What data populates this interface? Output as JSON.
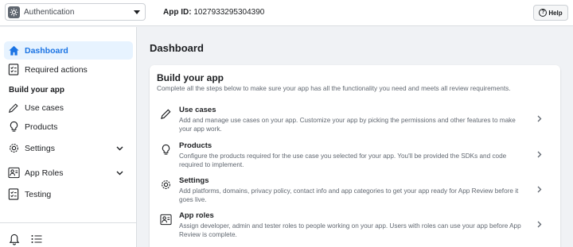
{
  "topbar": {
    "app_name": "Authentication",
    "app_id_label": "App ID:",
    "app_id_value": "1027933295304390",
    "help_label": "Help"
  },
  "sidebar": {
    "items_top": [
      {
        "label": "Dashboard",
        "icon": "home-icon",
        "active": true
      },
      {
        "label": "Required actions",
        "icon": "checklist-icon",
        "active": false
      }
    ],
    "section_title": "Build your app",
    "items_build": [
      {
        "label": "Use cases",
        "icon": "pencil-icon"
      },
      {
        "label": "Products",
        "icon": "lightbulb-icon"
      },
      {
        "label": "Settings",
        "icon": "gear-icon",
        "expandable": true
      },
      {
        "label": "App Roles",
        "icon": "people-icon",
        "expandable": true
      },
      {
        "label": "Testing",
        "icon": "checklist-icon"
      }
    ],
    "bottom_icons": [
      "bell-icon",
      "list-icon"
    ]
  },
  "main": {
    "page_title": "Dashboard",
    "card": {
      "title": "Build your app",
      "subtitle": "Complete all the steps below to make sure your app has all the functionality you need and meets all review requirements.",
      "steps": [
        {
          "title": "Use cases",
          "icon": "pencil-icon",
          "description": "Add and manage use cases on your app. Customize your app by picking the permissions and other features to make your app work."
        },
        {
          "title": "Products",
          "icon": "lightbulb-icon",
          "description": "Configure the products required for the use case you selected for your app. You'll be provided the SDKs and code required to implement."
        },
        {
          "title": "Settings",
          "icon": "gear-icon",
          "description": "Add platforms, domains, privacy policy, contact info and app categories to get your app ready for App Review before it goes live."
        },
        {
          "title": "App roles",
          "icon": "people-icon",
          "description": "Assign developer, admin and tester roles to people working on your app. Users with roles can use your app before App Review is complete."
        }
      ]
    }
  },
  "colors": {
    "accent": "#1b74e4",
    "active_bg": "#e7f3ff",
    "page_bg": "#f0f2f5"
  }
}
